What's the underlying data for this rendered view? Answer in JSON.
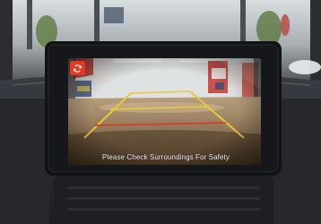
{
  "display": {
    "caption": "Please Check Surroundings For Safety",
    "camera_switch_icon": "camera-toggle-icon"
  },
  "colors": {
    "guide_yellow": "#e8c93a",
    "guide_red": "#d2412a",
    "button_red": "#e23b22",
    "dashboard": "#2a2c31"
  }
}
